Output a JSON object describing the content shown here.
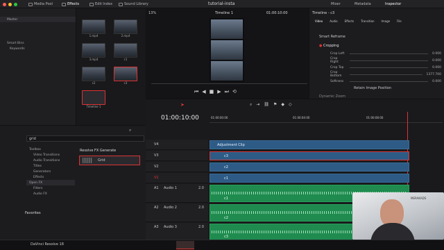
{
  "title_bar": {
    "buttons": [
      "Media Pool",
      "Effects",
      "Edit Index",
      "Sound Library"
    ],
    "project": "tutorial-insta",
    "right_buttons": [
      "Mixer",
      "Metadata",
      "Inspector"
    ]
  },
  "bins": {
    "master": "Master",
    "smart_bins": "Smart Bins",
    "keywords": "Keywords"
  },
  "media": [
    {
      "label": "1.mp4"
    },
    {
      "label": "2.mp4"
    },
    {
      "label": "3.mp4"
    },
    {
      "label": "c1"
    },
    {
      "label": "c2"
    },
    {
      "label": "c3"
    },
    {
      "label": "Timeline 1"
    }
  ],
  "viewer": {
    "zoom": "13%",
    "timeline": "Timeline 1",
    "timecode": "01:00:10:00"
  },
  "inspector": {
    "title": "Timeline - c3",
    "tabs": [
      "Video",
      "Audio",
      "Effects",
      "Transition",
      "Image",
      "File"
    ],
    "section1": "Smart Reframe",
    "section2": "Cropping",
    "params": [
      {
        "label": "Crop Left",
        "value": "0.000"
      },
      {
        "label": "Crop Right",
        "value": "0.000"
      },
      {
        "label": "Crop Top",
        "value": "0.000"
      },
      {
        "label": "Crop Bottom",
        "value": "1377.700"
      },
      {
        "label": "Softness",
        "value": "0.000"
      }
    ],
    "retain": "Retain Image Position",
    "dynamic_zoom": "Dynamic Zoom"
  },
  "fx": {
    "search": "grid",
    "tree": [
      "Toolbox",
      "Video Transitions",
      "Audio Transitions",
      "Titles",
      "Generators",
      "Effects",
      "Open FX",
      "Filters",
      "Audio FX",
      "Favorites"
    ],
    "category": "Resolve FX Generate",
    "item": "Grid"
  },
  "timeline": {
    "timecode": "01:00:10:00",
    "ruler": [
      "01:00:00:00",
      "01:00:04:00",
      "01:00:08:00"
    ],
    "tracks": [
      {
        "id": "V4",
        "clip": "Adjustment Clip"
      },
      {
        "id": "V3",
        "clip": "c3"
      },
      {
        "id": "V2",
        "clip": "c2"
      },
      {
        "id": "V1",
        "clip": "c1"
      },
      {
        "id": "A1",
        "name": "Audio 1",
        "level": "2.0",
        "clip": "c1"
      },
      {
        "id": "A2",
        "name": "Audio 2",
        "level": "2.0",
        "clip": "c2"
      },
      {
        "id": "A3",
        "name": "Audio 3",
        "level": "2.0",
        "clip": "c3"
      }
    ]
  },
  "brand": {
    "app": "DaVinci Resolve 18",
    "logo": "MERAKADS"
  },
  "colors": {
    "accent": "#d33333",
    "video": "#2d5b86",
    "audio": "#1f8b4f"
  }
}
